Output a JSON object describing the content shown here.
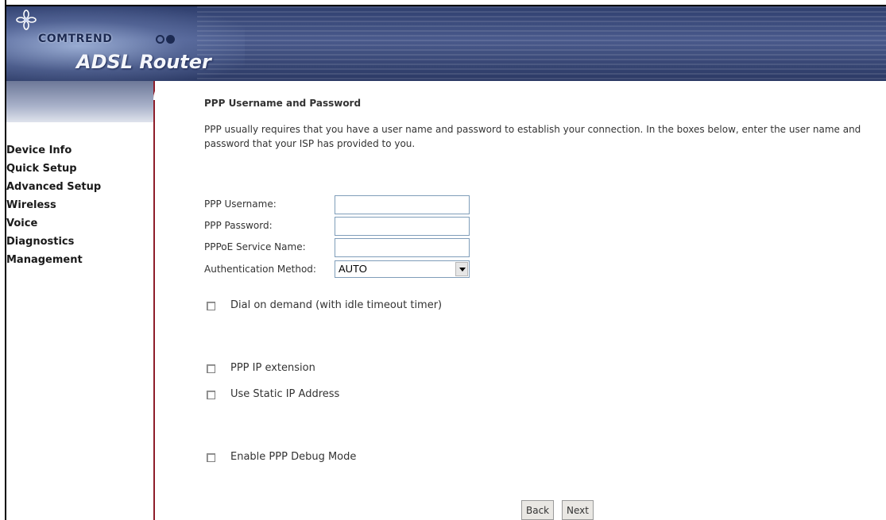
{
  "header": {
    "brand": "COMTREND",
    "product": "ADSL Router"
  },
  "sidebar": {
    "items": [
      {
        "label": "Device Info"
      },
      {
        "label": "Quick Setup"
      },
      {
        "label": "Advanced Setup"
      },
      {
        "label": "Wireless"
      },
      {
        "label": "Voice"
      },
      {
        "label": "Diagnostics"
      },
      {
        "label": "Management"
      }
    ]
  },
  "main": {
    "title": "PPP Username and Password",
    "intro": "PPP usually requires that you have a user name and password to establish your connection. In the boxes below, enter the user name and password that your ISP has provided to you.",
    "fields": {
      "username_label": "PPP Username:",
      "username_value": "",
      "password_label": "PPP Password:",
      "password_value": "",
      "service_label": "PPPoE Service Name:",
      "service_value": "",
      "auth_label": "Authentication Method:",
      "auth_value": "AUTO"
    },
    "checkboxes": {
      "dial_on_demand": "Dial on demand (with idle timeout timer)",
      "ip_extension": "PPP IP extension",
      "static_ip": "Use Static IP Address",
      "debug_mode": "Enable PPP Debug Mode"
    },
    "buttons": {
      "back": "Back",
      "next": "Next"
    }
  }
}
